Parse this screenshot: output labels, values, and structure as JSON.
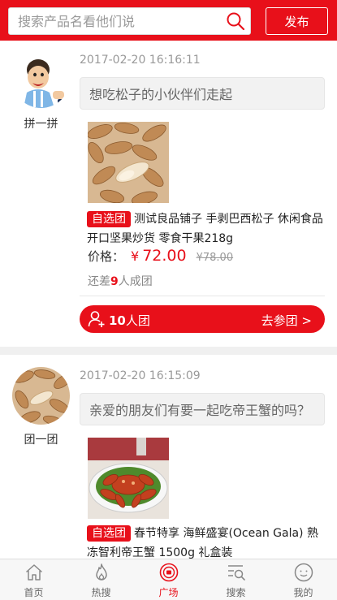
{
  "colors": {
    "accent": "#e8101a",
    "muted": "#999999",
    "background": "#f0f0f0"
  },
  "header": {
    "search_placeholder": "搜索产品名看他们说",
    "search_icon": "search-icon",
    "publish_label": "发布"
  },
  "posts": [
    {
      "user_name": "拼一拼",
      "time": "2017-02-20 16:16:11",
      "message": "想吃松子的小伙伴们走起",
      "tag": "自选团",
      "product_title": "测试良品铺子 手剥巴西松子 休闲食品 开口坚果炒货 零食干果218g",
      "price_label": "价格：",
      "currency": "¥",
      "price_now": "72.00",
      "price_old": "¥78.00",
      "remain_prefix": "还差",
      "remain_count": "9",
      "remain_suffix": "人成团",
      "group_count": "10",
      "group_unit": "人团",
      "join_label": "去参团 >"
    },
    {
      "user_name": "团一团",
      "time": "2017-02-20 16:15:09",
      "message": "亲爱的朋友们有要一起吃帝王蟹的吗？",
      "tag": "自选团",
      "product_title": "春节特享 海鲜盛宴(Ocean Gala) 熟冻智利帝王蟹 1500g 礼盒装"
    }
  ],
  "tabbar": [
    {
      "label": "首页",
      "icon": "home-icon"
    },
    {
      "label": "热搜",
      "icon": "flame-icon"
    },
    {
      "label": "广场",
      "icon": "plaza-icon",
      "active": true
    },
    {
      "label": "搜索",
      "icon": "search-list-icon"
    },
    {
      "label": "我的",
      "icon": "profile-icon"
    }
  ]
}
